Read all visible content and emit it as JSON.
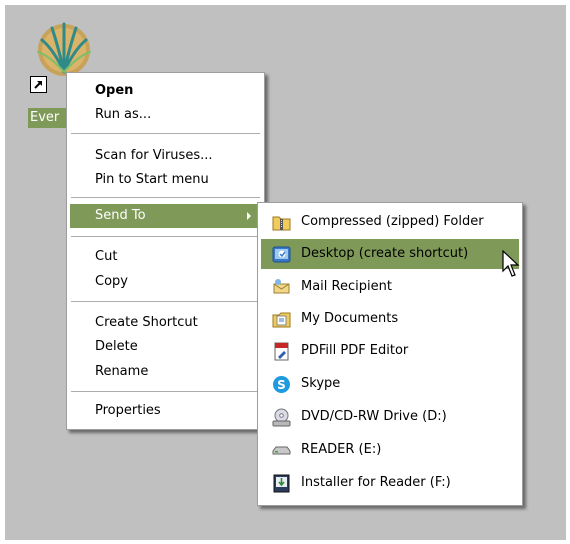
{
  "desktop_icon": {
    "label": "Ever"
  },
  "context_menu": {
    "items": [
      {
        "label": "Open",
        "bold": true
      },
      {
        "label": "Run as..."
      },
      {
        "label": "Scan for Viruses..."
      },
      {
        "label": "Pin to Start menu"
      },
      {
        "label": "Send To",
        "highlighted": true,
        "submenu": true
      },
      {
        "label": "Cut"
      },
      {
        "label": "Copy"
      },
      {
        "label": "Create Shortcut"
      },
      {
        "label": "Delete"
      },
      {
        "label": "Rename"
      },
      {
        "label": "Properties"
      }
    ]
  },
  "send_to_menu": {
    "items": [
      {
        "label": "Compressed (zipped) Folder",
        "icon": "zip-folder-icon"
      },
      {
        "label": "Desktop (create shortcut)",
        "icon": "desktop-shortcut-icon",
        "highlighted": true
      },
      {
        "label": "Mail Recipient",
        "icon": "mail-recipient-icon"
      },
      {
        "label": "My Documents",
        "icon": "my-documents-icon"
      },
      {
        "label": "PDFill PDF Editor",
        "icon": "pdfill-icon"
      },
      {
        "label": "Skype",
        "icon": "skype-icon"
      },
      {
        "label": "DVD/CD-RW Drive (D:)",
        "icon": "dvd-drive-icon"
      },
      {
        "label": "READER (E:)",
        "icon": "removable-drive-icon"
      },
      {
        "label": "Installer for Reader (F:)",
        "icon": "installer-drive-icon"
      }
    ]
  },
  "colors": {
    "desktop_background": "#c0c0c0",
    "highlight": "#7f9a58",
    "menu_background": "#ffffff"
  }
}
